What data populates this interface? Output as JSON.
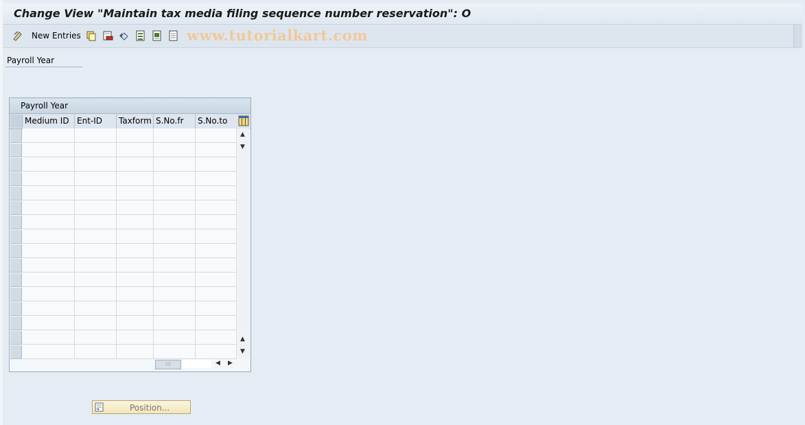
{
  "window": {
    "title": "Change View \"Maintain tax media filing sequence number reservation\": O"
  },
  "toolbar": {
    "new_entries_label": "New Entries",
    "icons": [
      "display-change-icon",
      "copy-icon",
      "delete-icon",
      "undo-icon",
      "select-all-icon",
      "select-block-icon",
      "deselect-all-icon"
    ],
    "watermark": "www.tutorialkart.com"
  },
  "selection": {
    "label": "Payroll Year"
  },
  "table": {
    "title": "Payroll Year",
    "columns": [
      "Medium ID",
      "Ent-ID",
      "Taxform",
      "S.No.fr",
      "S.No.to"
    ],
    "rows": [
      [
        "",
        "",
        "",
        "",
        ""
      ],
      [
        "",
        "",
        "",
        "",
        ""
      ],
      [
        "",
        "",
        "",
        "",
        ""
      ],
      [
        "",
        "",
        "",
        "",
        ""
      ],
      [
        "",
        "",
        "",
        "",
        ""
      ],
      [
        "",
        "",
        "",
        "",
        ""
      ],
      [
        "",
        "",
        "",
        "",
        ""
      ],
      [
        "",
        "",
        "",
        "",
        ""
      ],
      [
        "",
        "",
        "",
        "",
        ""
      ],
      [
        "",
        "",
        "",
        "",
        ""
      ],
      [
        "",
        "",
        "",
        "",
        ""
      ],
      [
        "",
        "",
        "",
        "",
        ""
      ],
      [
        "",
        "",
        "",
        "",
        ""
      ],
      [
        "",
        "",
        "",
        "",
        ""
      ],
      [
        "",
        "",
        "",
        "",
        ""
      ],
      [
        "",
        "",
        "",
        "",
        ""
      ]
    ]
  },
  "position_button": {
    "label": "Position..."
  },
  "colors": {
    "background": "#e5ecf3",
    "button_fill": "#f2e6b8",
    "watermark": "#f0c89a"
  }
}
